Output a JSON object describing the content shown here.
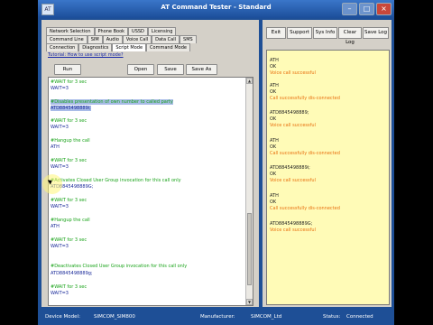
{
  "window": {
    "title": "AT Command Tester - Standard"
  },
  "tabs": {
    "row1": [
      "Network Selection",
      "Phone Book",
      "USSD",
      "Licensing"
    ],
    "row2": [
      "Command Line",
      "SIM",
      "Audio",
      "Voice Call",
      "Data Call",
      "SMS"
    ],
    "row3": [
      "Connection",
      "Diagnostics",
      "Script Mode",
      "Command Mode"
    ],
    "active": "Script Mode"
  },
  "script_panel": {
    "tutorial_link": "Tutorial: How to use script mode?",
    "buttons": {
      "run": "Run",
      "open": "Open",
      "save": "Save",
      "save_as": "Save As"
    },
    "lines": [
      "#WAIT for 3 sec",
      "WAIT=3",
      "#Disables presentation of own number to called party",
      "ATD8845498889i;",
      "#WAIT for 3 sec",
      "WAIT=3",
      "#Hangup the call",
      "ATH",
      "#WAIT for 3 sec",
      "WAIT=3",
      "#Activates Closed User Group invocation for this call only",
      "ATD8845498889G;",
      "#WAIT for 3 sec",
      "WAIT=3",
      "#Hangup the call",
      "ATH",
      "#WAIT for 3 sec",
      "WAIT=3",
      "#Deactivates Closed User Group invocation for this call only",
      "ATD8845498889g;",
      "#WAIT for 3 sec",
      "WAIT=3"
    ]
  },
  "log_panel": {
    "buttons": {
      "exit": "Exit",
      "support": "Support",
      "sys_info": "Sys Info",
      "clear_log": "Clear Log",
      "save_log": "Save Log"
    },
    "lines": [
      "ATH",
      "OK",
      "Voice call successful",
      "ATH",
      "OK",
      "Call successfully dis-connected",
      "ATD8845498889;",
      "OK",
      "Voice call successful",
      "ATH",
      "OK",
      "Call successfully dis-connected",
      "ATD8845498889i;",
      "OK",
      "Voice call successful",
      "ATH",
      "OK",
      "Call successfully dis-connected",
      "ATD8845498889G;",
      "Voice call successful"
    ]
  },
  "status_bar": {
    "device_model_label": "Device Model:",
    "device_model": "SIMCOM_SIM800",
    "manufacturer_label": "Manufacturer:",
    "manufacturer": "SIMCOM_Ltd",
    "status_label": "Status:",
    "status": "Connected"
  },
  "colors": {
    "comment": "#19a319",
    "command": "#1a2a9a",
    "log_result": "#e86f0e",
    "log_bg": "#fffbb7",
    "highlight": "#a9bce8"
  }
}
